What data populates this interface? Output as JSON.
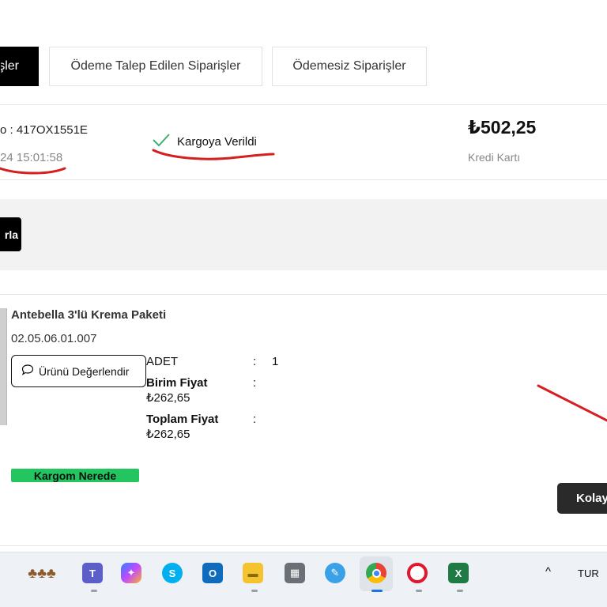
{
  "tabs": {
    "active_label": "şler",
    "payment_requested": "Ödeme Talep Edilen Siparişler",
    "unpaid": "Ödemesiz Siparişler"
  },
  "order": {
    "number_label": "o : 417OX1551E",
    "date": "24 15:01:58",
    "status": "Kargoya Verildi",
    "total": "₺502,25",
    "payment_method": "Kredi Kartı"
  },
  "band": {
    "button_label": "rla"
  },
  "product": {
    "name": "Antebella 3'lü Krema Paketi",
    "code": "02.05.06.01.007",
    "rate_button": "Ürünü Değerlendir",
    "qty_label": "ADET",
    "qty_value": "1",
    "unit_price_label": "Birim Fiyat",
    "unit_price_value": "₺262,65",
    "total_price_label": "Toplam Fiyat",
    "total_price_value": "₺262,65",
    "colon": ":"
  },
  "actions": {
    "track_button": "Kargom Nerede",
    "kolay_button": "Kolay"
  },
  "taskbar": {
    "icons": [
      "plant-app-icon",
      "teams-icon",
      "copilot-icon",
      "skype-icon",
      "outlook-icon",
      "file-explorer-icon",
      "calculator-icon",
      "paint-icon",
      "chrome-icon",
      "opera-icon",
      "excel-icon"
    ],
    "chevron": "^",
    "language": "TUR"
  },
  "colors": {
    "accent_black": "#000000",
    "track_green": "#22c55e",
    "annotation_red": "#d42020",
    "status_check": "#3cb371"
  }
}
